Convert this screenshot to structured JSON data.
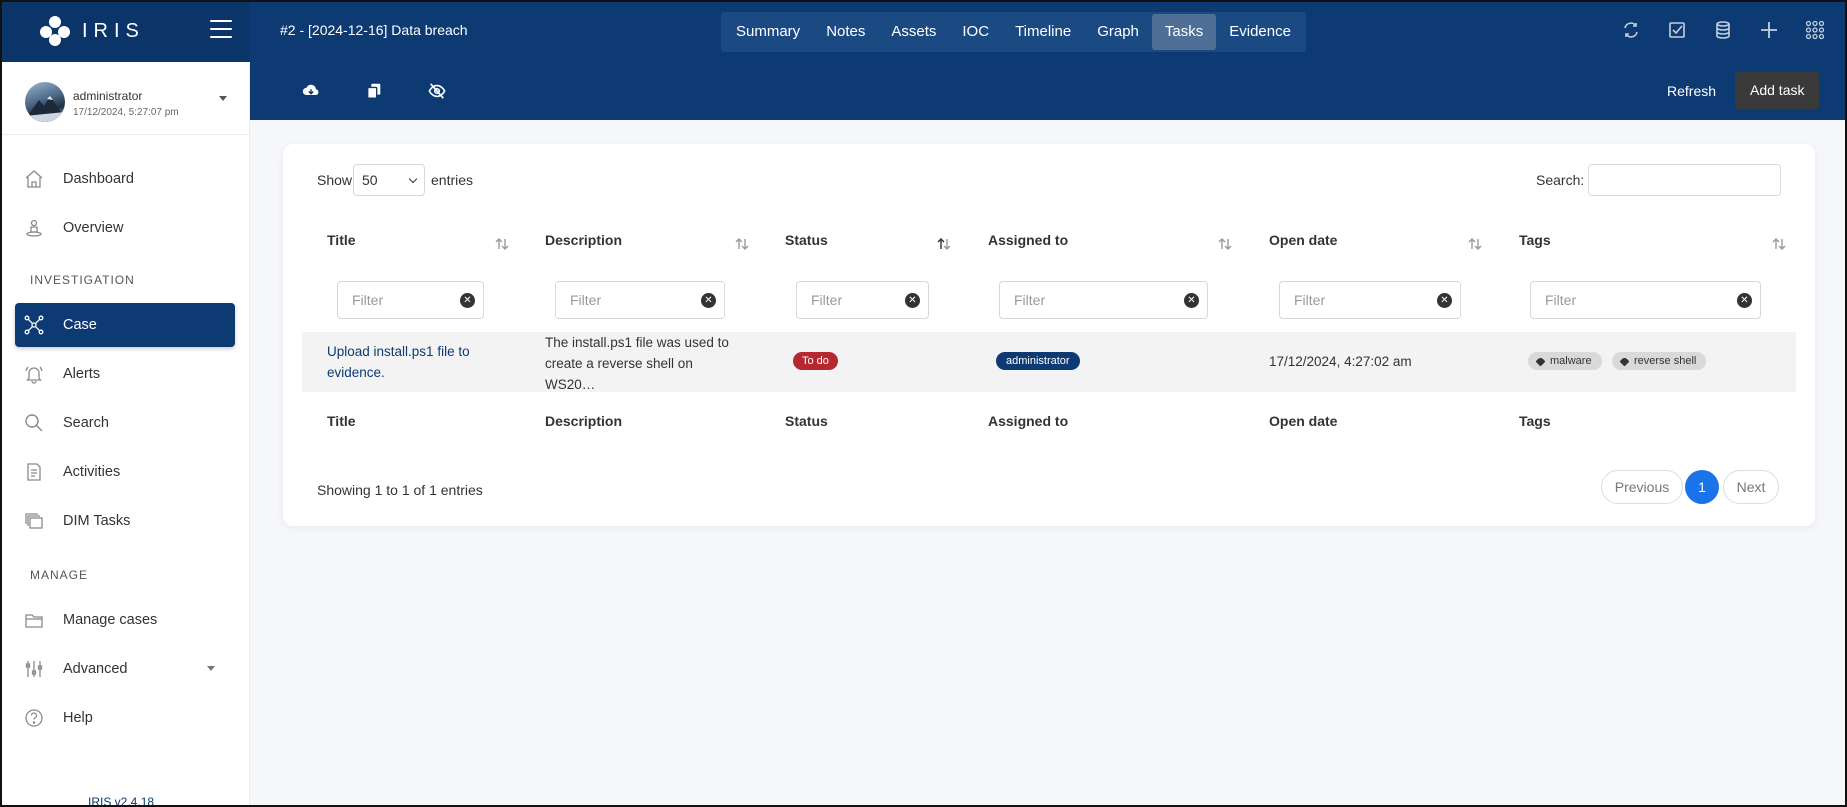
{
  "app": {
    "logo_text": "IRIS",
    "version": "IRIS v2.4.18"
  },
  "header": {
    "case_title": "#2 - [2024-12-16] Data breach",
    "tabs": [
      {
        "label": "Summary",
        "active": false
      },
      {
        "label": "Notes",
        "active": false
      },
      {
        "label": "Assets",
        "active": false
      },
      {
        "label": "IOC",
        "active": false
      },
      {
        "label": "Timeline",
        "active": false
      },
      {
        "label": "Graph",
        "active": false
      },
      {
        "label": "Tasks",
        "active": true
      },
      {
        "label": "Evidence",
        "active": false
      }
    ],
    "icons": [
      "sync-icon",
      "checkbox-icon",
      "database-icon",
      "plus-icon",
      "apps-grid-icon"
    ]
  },
  "toolbar": {
    "icons": [
      "cloud-download-icon",
      "copy-icon",
      "eye-slash-icon"
    ],
    "refresh_label": "Refresh",
    "add_task_label": "Add task"
  },
  "user": {
    "name": "administrator",
    "datetime": "17/12/2024, 5:27:07 pm"
  },
  "sidebar": {
    "items": [
      {
        "label": "Dashboard",
        "icon": "home-icon"
      },
      {
        "label": "Overview",
        "icon": "user-circle-icon"
      }
    ],
    "investigation_section": "INVESTIGATION",
    "investigation_items": [
      {
        "label": "Case",
        "icon": "network-icon",
        "active": true
      },
      {
        "label": "Alerts",
        "icon": "bell-icon"
      },
      {
        "label": "Search",
        "icon": "search-icon"
      },
      {
        "label": "Activities",
        "icon": "document-icon"
      },
      {
        "label": "DIM Tasks",
        "icon": "stack-icon"
      }
    ],
    "manage_section": "MANAGE",
    "manage_items": [
      {
        "label": "Manage cases",
        "icon": "folder-icon"
      },
      {
        "label": "Advanced",
        "icon": "sliders-icon"
      },
      {
        "label": "Help",
        "icon": "question-icon"
      }
    ]
  },
  "table": {
    "show_label": "Show",
    "entries_value": "50",
    "entries_label": "entries",
    "search_label": "Search:",
    "columns": [
      "Title",
      "Description",
      "Status",
      "Assigned to",
      "Open date",
      "Tags"
    ],
    "filter_placeholder": "Filter",
    "clear_symbol": "✕",
    "rows": [
      {
        "title_line1": "Upload install.ps1 file to",
        "title_line2": "evidence.",
        "description_line1": "The install.ps1 file was used to",
        "description_line2": "create a reverse shell on",
        "description_line3": "WS20…",
        "status": "To do",
        "status_color": "#b5282f",
        "assigned_to": "administrator",
        "open_date": "17/12/2024, 4:27:02 am",
        "tags": [
          "malware",
          "reverse shell"
        ]
      }
    ],
    "info": "Showing 1 to 1 of 1 entries",
    "pagination": {
      "previous": "Previous",
      "current": "1",
      "next": "Next"
    }
  },
  "colors": {
    "primary": "#0d3a73",
    "accent": "#1a73e8",
    "dark_button": "#3a3a3a"
  }
}
